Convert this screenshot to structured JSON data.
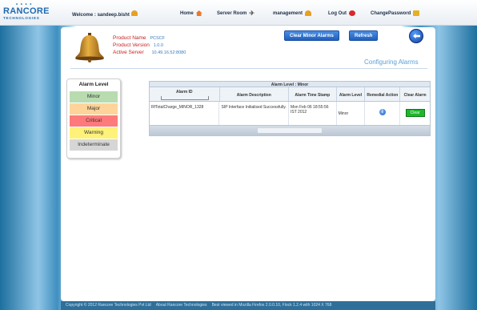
{
  "header": {
    "logo": {
      "brand": "RANCORE",
      "sub": "TECHNOLOGIES"
    },
    "welcome": "Welcome : sandeep.bisht",
    "nav": [
      {
        "label": "Home",
        "icon": "home-icon"
      },
      {
        "label": "Server Room",
        "icon": "plane-icon"
      },
      {
        "label": "management",
        "icon": "bell-icon"
      },
      {
        "label": "Log Out",
        "icon": "logout-icon"
      },
      {
        "label": "ChangePassword",
        "icon": "key-icon"
      }
    ]
  },
  "product": {
    "name_label": "Product Name",
    "name_value": "PCSCF",
    "version_label": "Product Version",
    "version_value": "1.0.0",
    "server_label": "Active Server",
    "server_value": "10.49.16.52:8080"
  },
  "buttons": {
    "clear_minor": "Clear Minor Alarms",
    "refresh": "Refresh"
  },
  "page_title": "Configuring Alarms",
  "alarm_levels": {
    "title": "Alarm Level",
    "items": [
      {
        "label": "Minor",
        "color": "#b8dcb0"
      },
      {
        "label": "Major",
        "color": "#ffd49a"
      },
      {
        "label": "Critical",
        "color": "#ff7a7a"
      },
      {
        "label": "Warning",
        "color": "#fff27a"
      },
      {
        "label": "Indeterminate",
        "color": "#d6d6d6"
      }
    ]
  },
  "table": {
    "title": "Alarm Level : Minor",
    "columns": [
      "Alarm ID",
      "Alarm Description",
      "Alarm Time Stamp",
      "Alarm Level",
      "Remedial Action",
      "Clear Alarm"
    ],
    "rows": [
      {
        "alarm_id": "RfTotalCharge_MINOR_1328",
        "description": "SIP Interface Initialised Successfully.",
        "timestamp": "Mon Feb 06 18:55:56 IST 2012",
        "level": "Minor",
        "action_icon": "info-icon",
        "clear_label": "Clear"
      }
    ]
  },
  "footer": {
    "copyright": "Copyright © 2012 Rancore Technologies Pvt Ltd",
    "about": "About Rancore Technologies",
    "best_viewed": "Best viewed in Mozilla Firefox 2.0.0.10, Flock 1.2.4 with 1024 X 768"
  }
}
